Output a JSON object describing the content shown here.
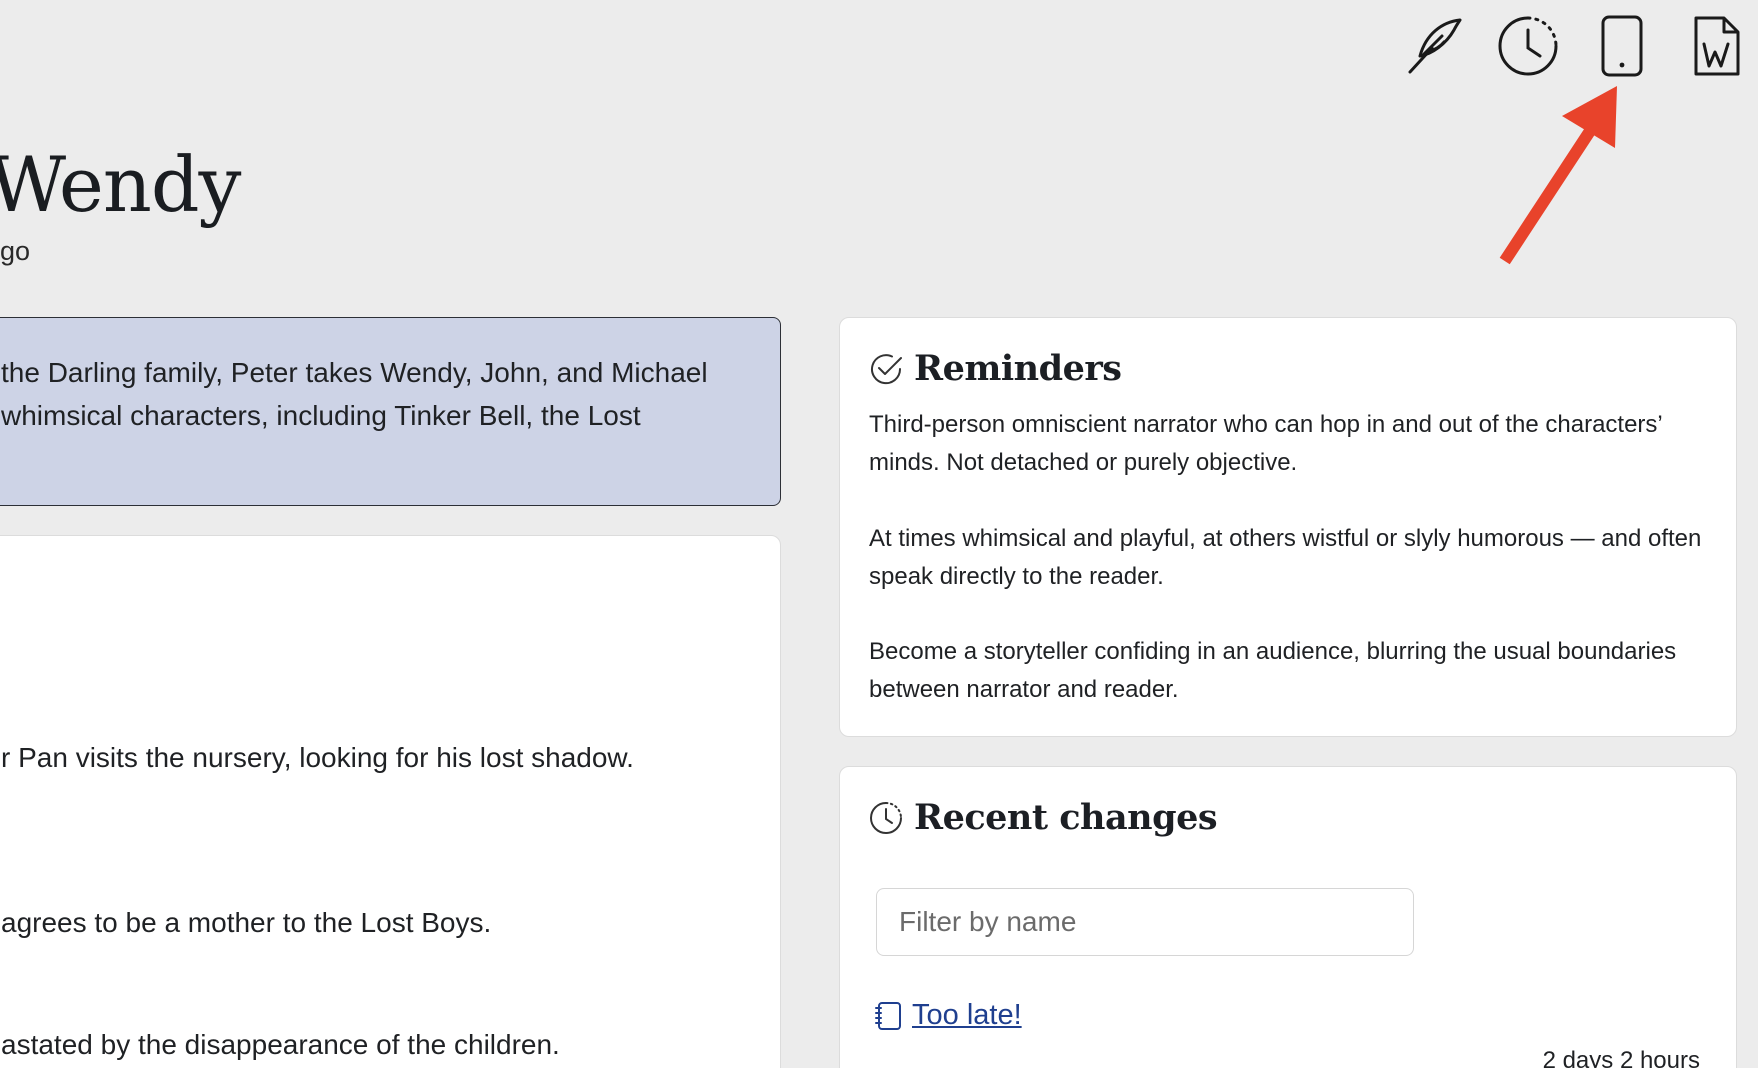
{
  "toolbar": {
    "icons": [
      "quill-icon",
      "history-clock-icon",
      "tablet-icon",
      "word-document-icon"
    ]
  },
  "document": {
    "title": "Wendy",
    "subtitle": "go"
  },
  "summary": {
    "lines": [
      "the Darling family, Peter takes Wendy, John, and Michael",
      "whimsical characters, including Tinker Bell, the Lost"
    ]
  },
  "main": {
    "lines": [
      "r Pan visits the nursery, looking for his lost shadow.",
      "agrees to be a mother to the Lost Boys.",
      "astated by the disappearance of the children."
    ]
  },
  "reminders": {
    "title": "Reminders",
    "paragraphs": [
      "Third-person omniscient narrator who can hop in and out of the characters’ minds. Not detached or purely objective.",
      "At times whimsical and playful, at others wistful or slyly humorous — and often speak directly to the reader.",
      "Become a storyteller confiding in an audience, blurring the usual boundaries between narrator and reader."
    ]
  },
  "recent_changes": {
    "title": "Recent changes",
    "filter_placeholder": "Filter by name",
    "items": [
      {
        "label": "Too late!",
        "time": "2 days 2 hours"
      }
    ]
  },
  "colors": {
    "background": "#ececec",
    "summary_bg": "#cdd3e6",
    "link": "#1f3f8f",
    "annotation_arrow": "#e8432b"
  }
}
